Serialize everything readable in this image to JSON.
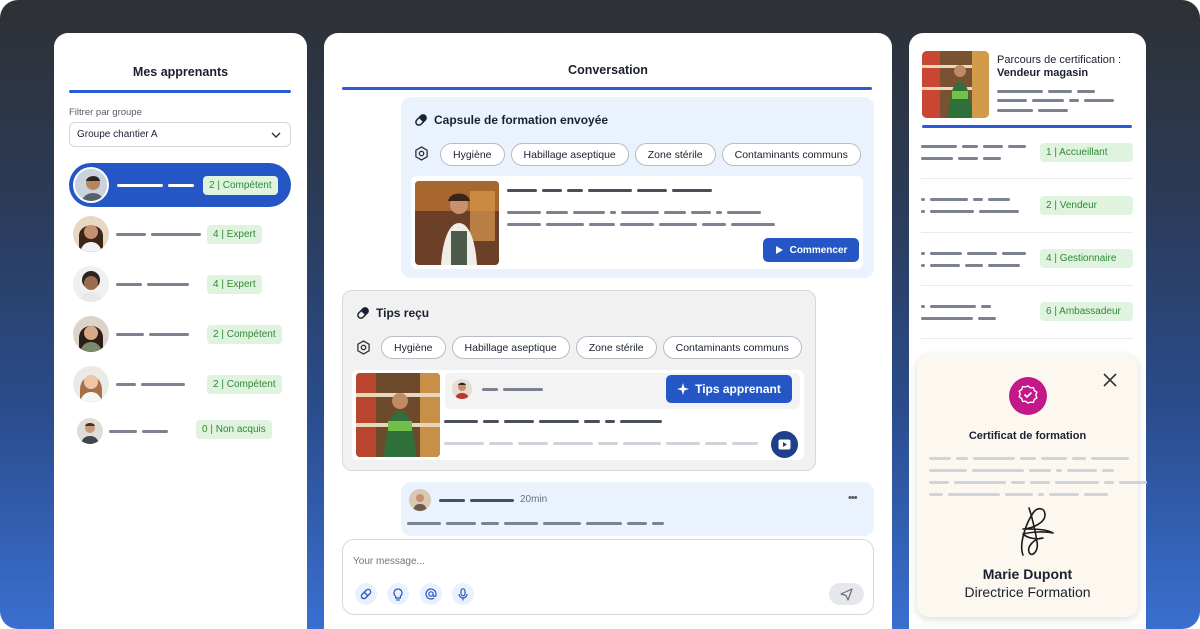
{
  "colors": {
    "accent": "#2457c5",
    "badge_bg": "#dff3df",
    "badge_text": "#2f8a35",
    "cert_seal": "#c2188a"
  },
  "left": {
    "title": "Mes apprenants",
    "filter_label": "Filtrer par groupe",
    "filter_value": "Groupe chantier A",
    "students": [
      {
        "badge": "2 | Compétent"
      },
      {
        "badge": "4 | Expert"
      },
      {
        "badge": "4 | Expert"
      },
      {
        "badge": "2 | Compétent"
      },
      {
        "badge": "2 | Compétent"
      },
      {
        "badge": "0 | Non acquis"
      }
    ]
  },
  "mid": {
    "title": "Conversation",
    "capsule": {
      "title": "Capsule de formation envoyée",
      "tags": [
        "Hygiène",
        "Habillage aseptique",
        "Zone stérile",
        "Contaminants communs"
      ],
      "start_label": "Commencer"
    },
    "tips": {
      "title": "Tips reçu",
      "tags": [
        "Hygiène",
        "Habillage aseptique",
        "Zone stérile",
        "Contaminants communs"
      ],
      "button_label": "Tips apprenant"
    },
    "message": {
      "time": "20min",
      "more": "•••"
    },
    "composer": {
      "placeholder": "Your message..."
    }
  },
  "right": {
    "path_label": "Parcours de certification :",
    "path_role": "Vendeur magasin",
    "levels": [
      "1 | Accueillant",
      "2 | Vendeur",
      "4 | Gestionnaire",
      "6 | Ambassadeur"
    ],
    "certificate": {
      "title": "Certificat de formation",
      "name": "Marie Dupont",
      "role": "Directrice Formation"
    }
  }
}
